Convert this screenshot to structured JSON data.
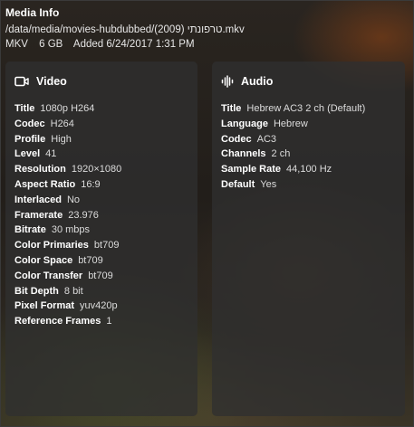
{
  "header": {
    "title": "Media Info",
    "path": "/data/media/movies-hubdubbed/(2009) טרפונתי.mkv",
    "container": "MKV",
    "size": "6 GB",
    "added": "Added 6/24/2017 1:31 PM"
  },
  "video": {
    "icon": "video-icon",
    "heading": "Video",
    "rows": [
      {
        "key": "Title",
        "value": "1080p H264"
      },
      {
        "key": "Codec",
        "value": "H264"
      },
      {
        "key": "Profile",
        "value": "High"
      },
      {
        "key": "Level",
        "value": "41"
      },
      {
        "key": "Resolution",
        "value": "1920×1080"
      },
      {
        "key": "Aspect Ratio",
        "value": "16:9"
      },
      {
        "key": "Interlaced",
        "value": "No"
      },
      {
        "key": "Framerate",
        "value": "23.976"
      },
      {
        "key": "Bitrate",
        "value": "30 mbps"
      },
      {
        "key": "Color Primaries",
        "value": "bt709"
      },
      {
        "key": "Color Space",
        "value": "bt709"
      },
      {
        "key": "Color Transfer",
        "value": "bt709"
      },
      {
        "key": "Bit Depth",
        "value": "8 bit"
      },
      {
        "key": "Pixel Format",
        "value": "yuv420p"
      },
      {
        "key": "Reference Frames",
        "value": "1"
      }
    ]
  },
  "audio": {
    "icon": "audio-waveform-icon",
    "heading": "Audio",
    "rows": [
      {
        "key": "Title",
        "value": "Hebrew AC3 2 ch (Default)"
      },
      {
        "key": "Language",
        "value": "Hebrew"
      },
      {
        "key": "Codec",
        "value": "AC3"
      },
      {
        "key": "Channels",
        "value": "2 ch"
      },
      {
        "key": "Sample Rate",
        "value": "44,100 Hz"
      },
      {
        "key": "Default",
        "value": "Yes"
      }
    ]
  }
}
